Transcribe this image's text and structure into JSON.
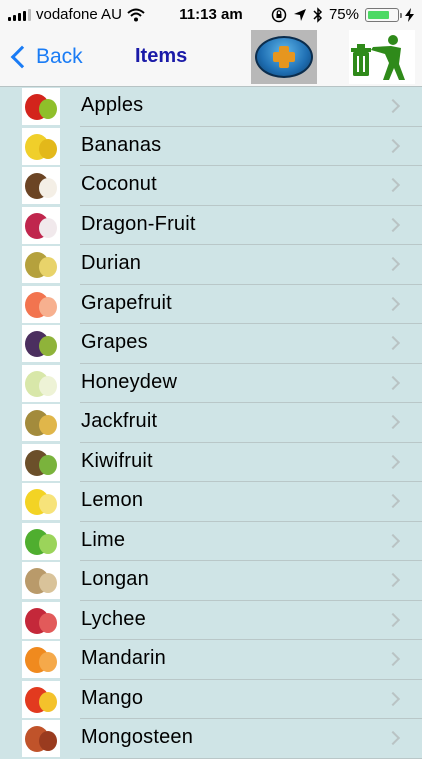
{
  "status_bar": {
    "carrier": "vodafone AU",
    "time": "11:13 am",
    "battery_percent": "75%",
    "battery_level": 0.75
  },
  "nav": {
    "back_label": "Back",
    "title": "Items",
    "add_icon": "add-plus-icon",
    "delete_icon": "recycle-trash-icon"
  },
  "items": [
    {
      "label": "Apples",
      "colors": [
        "#d3241c",
        "#8fbf2a"
      ]
    },
    {
      "label": "Bananas",
      "colors": [
        "#f0cf2a",
        "#e3b81a"
      ]
    },
    {
      "label": "Coconut",
      "colors": [
        "#6b4424",
        "#f4efe6"
      ]
    },
    {
      "label": "Dragon-Fruit",
      "colors": [
        "#c0264d",
        "#f1e9ec"
      ]
    },
    {
      "label": "Durian",
      "colors": [
        "#b5a13d",
        "#e8d36a"
      ]
    },
    {
      "label": "Grapefruit",
      "colors": [
        "#f2744f",
        "#f7b08f"
      ]
    },
    {
      "label": "Grapes",
      "colors": [
        "#4b2f5f",
        "#8fb33a"
      ]
    },
    {
      "label": "Honeydew",
      "colors": [
        "#d8e7a9",
        "#eef3d6"
      ]
    },
    {
      "label": "Jackfruit",
      "colors": [
        "#a38b3c",
        "#e0b64a"
      ]
    },
    {
      "label": "Kiwifruit",
      "colors": [
        "#6b4f2a",
        "#7ab33c"
      ]
    },
    {
      "label": "Lemon",
      "colors": [
        "#f3d324",
        "#f7e37a"
      ]
    },
    {
      "label": "Lime",
      "colors": [
        "#4fae2f",
        "#9bd45a"
      ]
    },
    {
      "label": "Longan",
      "colors": [
        "#b99a6a",
        "#d9c39a"
      ]
    },
    {
      "label": "Lychee",
      "colors": [
        "#c4283a",
        "#e25a5a"
      ]
    },
    {
      "label": "Mandarin",
      "colors": [
        "#f08a1e",
        "#f5a94a"
      ]
    },
    {
      "label": "Mango",
      "colors": [
        "#e23a1f",
        "#f4c22b"
      ]
    },
    {
      "label": "Mongosteen",
      "colors": [
        "#c0532a",
        "#9a3b1f"
      ]
    }
  ]
}
